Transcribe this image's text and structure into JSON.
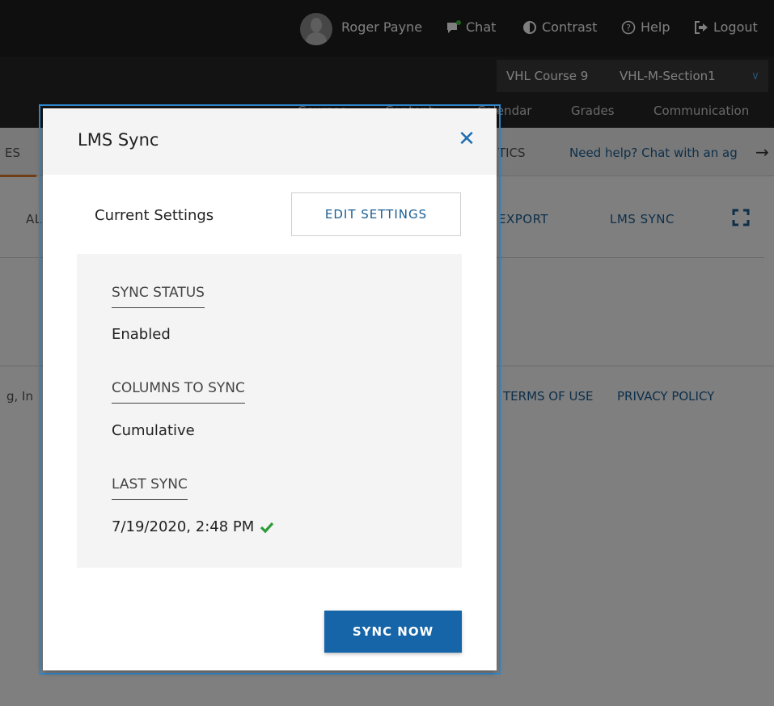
{
  "topbar": {
    "user_name": "Roger Payne",
    "chat_label": "Chat",
    "contrast_label": "Contrast",
    "help_label": "Help",
    "logout_label": "Logout"
  },
  "course": {
    "course_name": "VHL Course 9",
    "section_name": "VHL-M-Section1"
  },
  "nav": {
    "items": [
      "Courses",
      "Content",
      "Calendar",
      "Grades",
      "Communication"
    ]
  },
  "subnav": {
    "active_tab_fragment": "ES",
    "analytics_fragment": "TICS",
    "help_text": "Need help? Chat with an ag"
  },
  "toolbar": {
    "left_fragment": "AL",
    "export_label": "EXPORT",
    "lms_sync_label": "LMS SYNC"
  },
  "footer": {
    "left_fragment": "g, In",
    "terms_label": "TERMS OF USE",
    "privacy_label": "PRIVACY POLICY"
  },
  "modal": {
    "title": "LMS Sync",
    "current_settings_label": "Current Settings",
    "edit_settings_label": "EDIT SETTINGS",
    "sync_status_label": "SYNC STATUS",
    "sync_status_value": "Enabled",
    "columns_label": "COLUMNS TO SYNC",
    "columns_value": "Cumulative",
    "last_sync_label": "LAST SYNC",
    "last_sync_value": "7/19/2020, 2:48 PM",
    "sync_now_label": "SYNC NOW"
  },
  "colors": {
    "accent_blue": "#1565a8",
    "success_green": "#2e9b3a",
    "active_tab_orange": "#e07b2c"
  }
}
